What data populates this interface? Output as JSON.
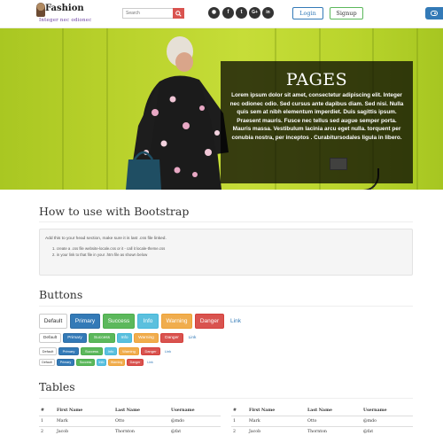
{
  "header": {
    "logo": {
      "brand": "Fashion",
      "tagline": "Integer nec odionec"
    },
    "search": {
      "placeholder": "Search"
    },
    "social": [
      {
        "icon": "rss-icon",
        "glyph": "◉"
      },
      {
        "icon": "facebook-icon",
        "glyph": "f"
      },
      {
        "icon": "twitter-icon",
        "glyph": "t"
      },
      {
        "icon": "google-plus-icon",
        "glyph": "G+"
      },
      {
        "icon": "linkedin-icon",
        "glyph": "in"
      }
    ],
    "login_label": "Login",
    "signup_label": "Signup",
    "colors": {
      "login_border": "#337ab7",
      "signup_border": "#5cb85c",
      "toggle": "#337ab7"
    }
  },
  "hero": {
    "title": "PAGES",
    "body": "Lorem ipsum dolor sit amet, consectetur adipiscing elit. Integer nec odionec odio. Sed cursus ante dapibus diam. Sed nisi. Nulla quis sem at nibh elementum imperdiet. Duis sagittis ipsum. Praesent mauris. Fusce nec tellus sed augue semper porta. Mauris massa. Vestibulum lacinia arcu eget nulla. torquent per conubia nostra, per inceptos . Curabitursodales ligula in libero.",
    "colors": {
      "background": "#b8d12b",
      "overlay": "rgba(0,0,0,0.72)"
    }
  },
  "bootstrap_section": {
    "title": "How to use with Bootstrap",
    "intro": "Add this to your head section, make sure it is last .css file linked.",
    "steps": [
      "1.  create a .css file website-locale.css or it - call it locale-theme.css",
      "2.  in your link to that file in your .htm file as shown below"
    ]
  },
  "buttons_section": {
    "title": "Buttons",
    "labels": [
      "Default",
      "Primary",
      "Success",
      "Info",
      "Warning",
      "Danger",
      "Link"
    ]
  },
  "tables_section": {
    "title": "Tables",
    "headers": [
      "#",
      "First Name",
      "Last Name",
      "Username"
    ],
    "rows": [
      [
        "1",
        "Mark",
        "Otto",
        "@mdo"
      ],
      [
        "2",
        "Jacob",
        "Thornton",
        "@fat"
      ]
    ]
  }
}
